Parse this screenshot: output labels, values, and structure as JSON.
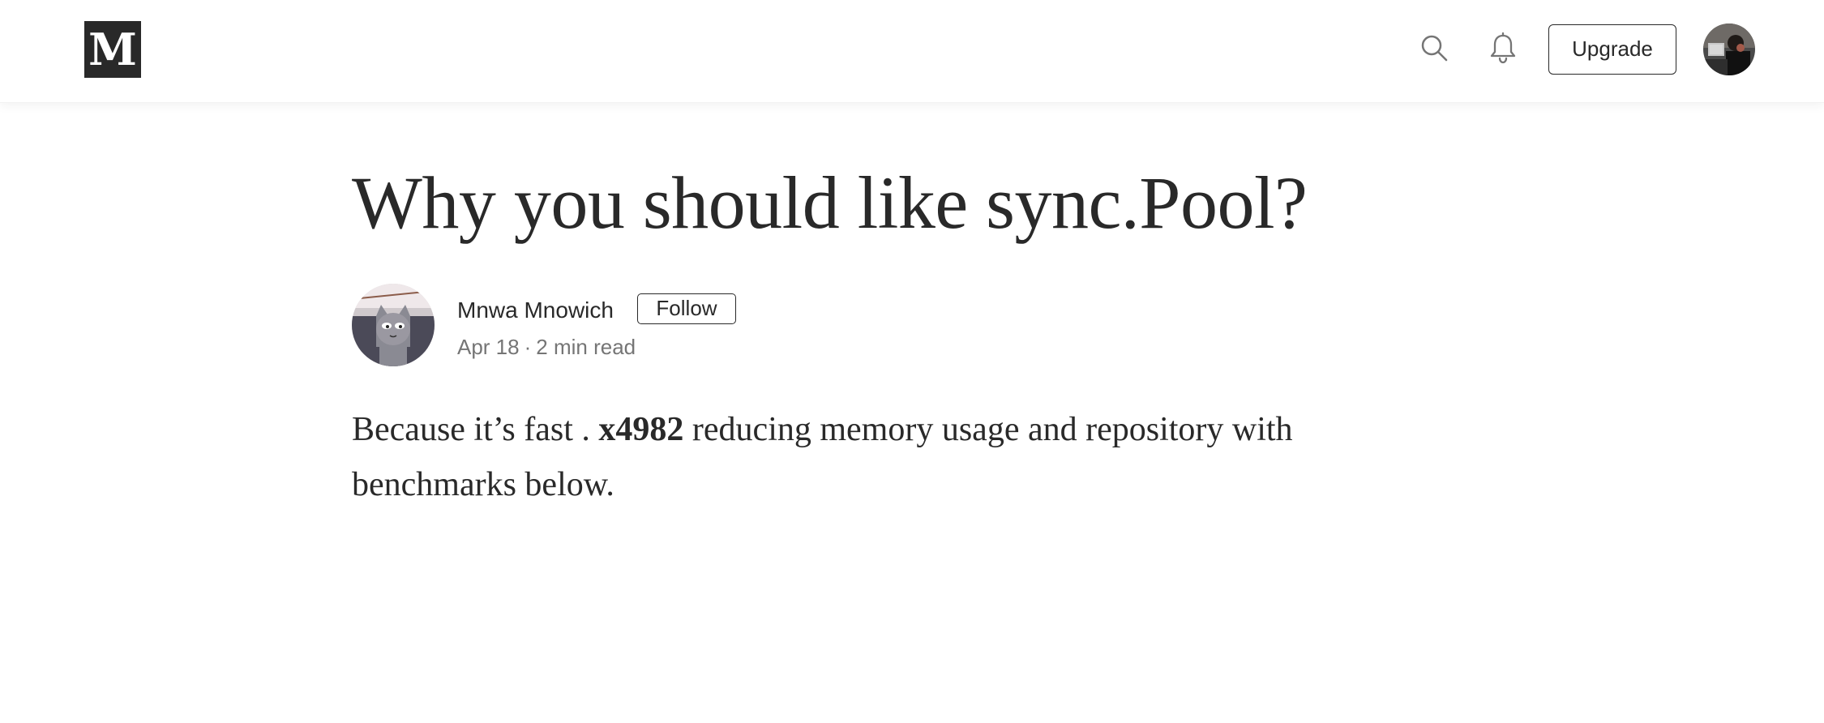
{
  "header": {
    "logo_text": "M",
    "search_icon": "search-icon",
    "bell_icon": "bell-icon",
    "upgrade_label": "Upgrade"
  },
  "article": {
    "title": "Why you should like sync.Pool?",
    "author": {
      "name": "Mnwa Mnowich",
      "follow_label": "Follow"
    },
    "meta": {
      "date": "Apr 18",
      "separator": "·",
      "read_time": "2 min read"
    },
    "body": {
      "intro": "Because it’s fast . ",
      "highlight": "x4982",
      "rest_line1": " reducing memory usage and repository with",
      "rest_line2": "benchmarks below."
    }
  },
  "colors": {
    "text": "#292929",
    "muted": "#757575",
    "logo_bg": "#292929"
  }
}
